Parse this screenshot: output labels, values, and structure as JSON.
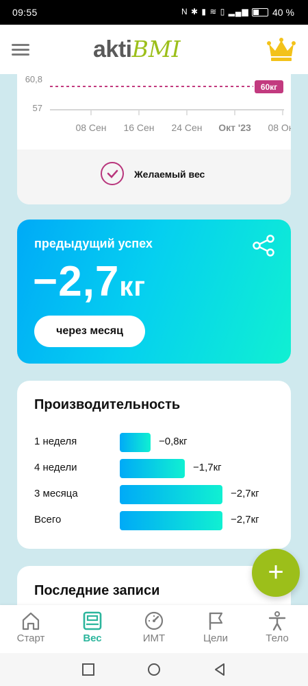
{
  "status_bar": {
    "time": "09:55",
    "battery": "40 %"
  },
  "app": {
    "logo_part1": "akti",
    "logo_part2": "BMI"
  },
  "chart_data": {
    "type": "line",
    "y_tick_labels": [
      "60,8",
      "57"
    ],
    "x_tick_labels": [
      "08 Сен",
      "16 Сен",
      "24 Сен",
      "Окт '23",
      "08 Окт"
    ],
    "target_badge": "60кг",
    "legend_label": "Желаемый вес"
  },
  "success": {
    "title": "предыдущий успех",
    "value": "−2,7",
    "unit": "кг",
    "period_button": "через месяц"
  },
  "performance": {
    "title": "Производительность",
    "rows": [
      {
        "label": "1 неделя",
        "value": "−0,8кг",
        "fraction": 0.3
      },
      {
        "label": "4 недели",
        "value": "−1,7кг",
        "fraction": 0.63
      },
      {
        "label": "3 месяца",
        "value": "−2,7кг",
        "fraction": 1.0
      },
      {
        "label": "Всего",
        "value": "−2,7кг",
        "fraction": 1.0
      }
    ]
  },
  "records": {
    "title": "Последние записи"
  },
  "nav": [
    {
      "label": "Старт",
      "icon": "home-icon"
    },
    {
      "label": "Вес",
      "icon": "scale-icon",
      "active": true
    },
    {
      "label": "ИМТ",
      "icon": "gauge-icon"
    },
    {
      "label": "Цели",
      "icon": "flag-icon"
    },
    {
      "label": "Тело",
      "icon": "body-icon"
    }
  ],
  "colors": {
    "brand_green": "#9cbf1a",
    "target_magenta": "#c23a7f",
    "gradient_start": "#00aaf7",
    "gradient_end": "#10f0d2",
    "active_nav": "#2bb59c"
  }
}
